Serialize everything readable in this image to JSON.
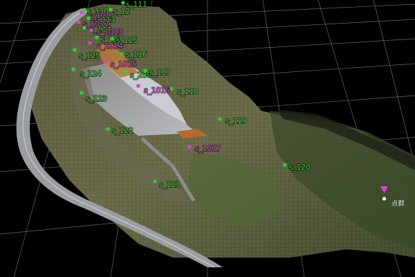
{
  "viewer": {
    "background": "#000000",
    "grid_color": "#bfbfbf"
  },
  "marker_colors": {
    "control": "#2bd32b",
    "check": "#e03ce0"
  },
  "pointcloud_label": "点群",
  "markers": [
    {
      "id": "s_130",
      "type": "control"
    },
    {
      "id": "s_111",
      "type": "control"
    },
    {
      "id": "s_12",
      "type": "control"
    },
    {
      "id": "s_1011",
      "type": "check"
    },
    {
      "id": "s_113",
      "type": "control"
    },
    {
      "id": "s_1012",
      "type": "check"
    },
    {
      "id": "s_114",
      "type": "control"
    },
    {
      "id": "s_1013",
      "type": "check"
    },
    {
      "id": "s_207",
      "type": "control"
    },
    {
      "id": "s_115",
      "type": "control"
    },
    {
      "id": "s_1014",
      "type": "check"
    },
    {
      "id": "s_125",
      "type": "control"
    },
    {
      "id": "s_116",
      "type": "control"
    },
    {
      "id": "s_1015",
      "type": "check"
    },
    {
      "id": "s_124",
      "type": "control"
    },
    {
      "id": "s_208",
      "type": "control"
    },
    {
      "id": "s_117",
      "type": "control"
    },
    {
      "id": "s_1016",
      "type": "check"
    },
    {
      "id": "s_118",
      "type": "control"
    },
    {
      "id": "s_123",
      "type": "control"
    },
    {
      "id": "s_119",
      "type": "control"
    },
    {
      "id": "s_122",
      "type": "control"
    },
    {
      "id": "s_1017",
      "type": "check"
    },
    {
      "id": "s_120",
      "type": "control"
    },
    {
      "id": "s_121",
      "type": "control"
    }
  ]
}
